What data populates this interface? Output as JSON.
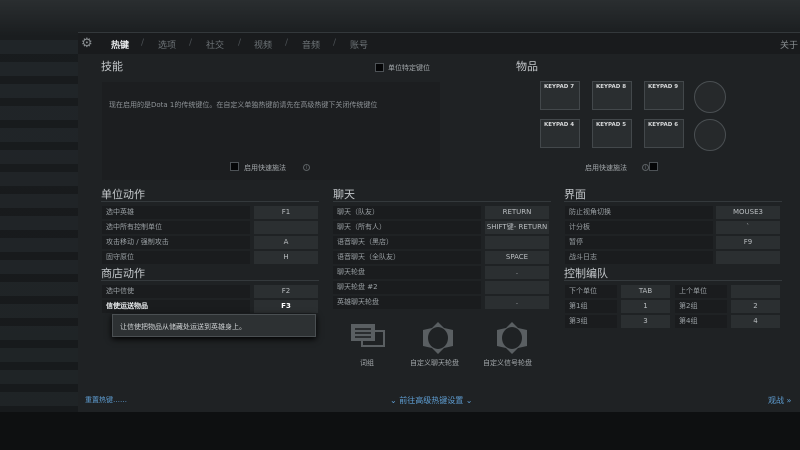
{
  "top_right": "关于",
  "tabs": [
    {
      "label": "热键"
    },
    {
      "label": "选项"
    },
    {
      "label": "社交"
    },
    {
      "label": "视频"
    },
    {
      "label": "音频"
    },
    {
      "label": "账号"
    }
  ],
  "skills": {
    "title": "技能",
    "unit_specific": "单位特定键位",
    "notice": "现在启用的是Dota 1的传统键位。在自定义单独热键前请先在高级热键下关闭传统键位",
    "quickcast": "启用快速施法"
  },
  "items": {
    "title": "物品",
    "keys": [
      "KEYPAD 7",
      "KEYPAD 8",
      "KEYPAD 9",
      "KEYPAD 4",
      "KEYPAD 5",
      "KEYPAD 6"
    ],
    "quickcast": "启用快速施法"
  },
  "unit_actions": {
    "title": "单位动作",
    "rows": [
      {
        "label": "选中英雄",
        "key": "F1"
      },
      {
        "label": "选中所有控制单位",
        "key": ""
      },
      {
        "label": "攻击移动 / 强制攻击",
        "key": "A"
      },
      {
        "label": "固守原位",
        "key": "H"
      }
    ]
  },
  "shop_actions": {
    "title": "商店动作",
    "rows": [
      {
        "label": "选中信使",
        "key": "F2"
      },
      {
        "label": "信使运送物品",
        "key": "F3"
      }
    ],
    "tooltip": "让信使把物品从储藏处运送到英雄身上。"
  },
  "chat": {
    "title": "聊天",
    "rows": [
      {
        "label": "聊天（队友）",
        "key": "RETURN"
      },
      {
        "label": "聊天（所有人）",
        "key": "SHIFT键- RETURN"
      },
      {
        "label": "语音聊天（黑店）",
        "key": ""
      },
      {
        "label": "语音聊天（全队友）",
        "key": "SPACE"
      },
      {
        "label": "聊天轮盘",
        "key": "."
      },
      {
        "label": "聊天轮盘 #2",
        "key": ""
      },
      {
        "label": "英雄聊天轮盘",
        "key": "."
      }
    ]
  },
  "interface": {
    "title": "界面",
    "rows": [
      {
        "label": "防止视角切换",
        "key": "MOUSE3"
      },
      {
        "label": "计分板",
        "key": "`"
      },
      {
        "label": "暂停",
        "key": "F9"
      },
      {
        "label": "战斗日志",
        "key": ""
      }
    ]
  },
  "control_groups": {
    "title": "控制编队",
    "rows": [
      {
        "l1": "下个单位",
        "k1": "TAB",
        "l2": "上个单位",
        "k2": ""
      },
      {
        "l1": "第1组",
        "k1": "1",
        "l2": "第2组",
        "k2": "2"
      },
      {
        "l1": "第3组",
        "k1": "3",
        "l2": "第4组",
        "k2": "4"
      }
    ]
  },
  "wheels": [
    {
      "label": "词组"
    },
    {
      "label": "自定义聊天轮盘"
    },
    {
      "label": "自定义信号轮盘"
    }
  ],
  "footer": {
    "reset": "重置热键……",
    "advanced": "前往高级热键设置",
    "spectate": "观战 »"
  }
}
